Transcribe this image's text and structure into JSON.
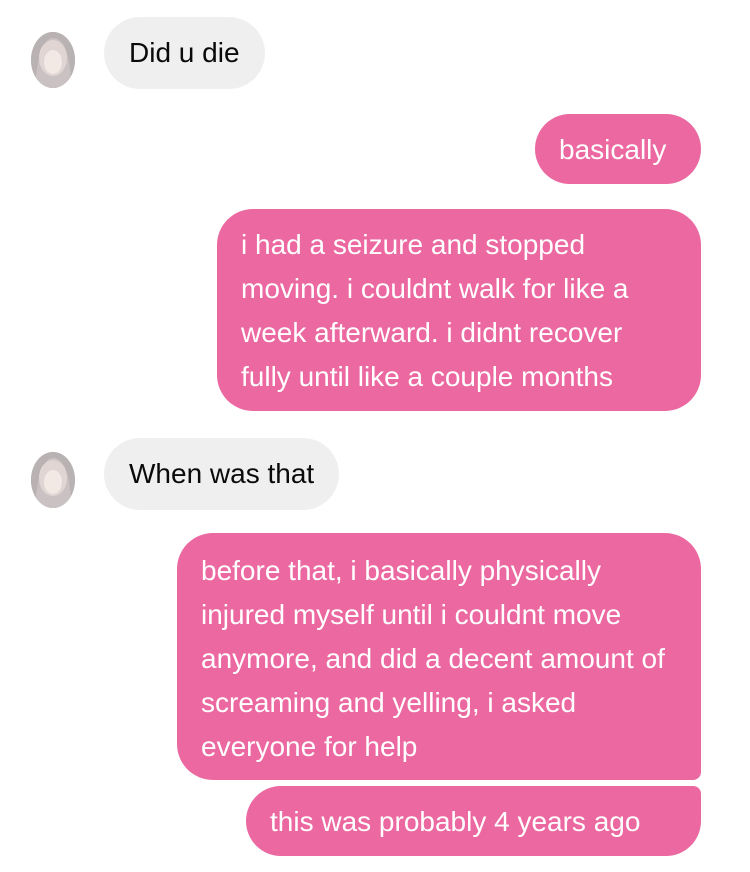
{
  "messages": [
    {
      "side": "received",
      "text": "Did u die",
      "avatar_icon": "user-avatar-icon"
    },
    {
      "side": "sent",
      "text": "basically"
    },
    {
      "side": "sent",
      "text": "i had a seizure and stopped moving. i couldnt walk for like a week afterward. i didnt recover fully until like a couple months"
    },
    {
      "side": "received",
      "text": "When was that",
      "avatar_icon": "user-avatar-icon"
    },
    {
      "side": "sent",
      "text": "before that, i basically physically injured myself until i couldnt move anymore, and did a decent amount of screaming and yelling, i asked everyone for help"
    },
    {
      "side": "sent",
      "text": "this was probably 4 years ago"
    }
  ],
  "colors": {
    "sent_bubble": "#eb68a0",
    "received_bubble": "#efefef",
    "sent_text": "#ffffff",
    "received_text": "#0a0a0a"
  }
}
